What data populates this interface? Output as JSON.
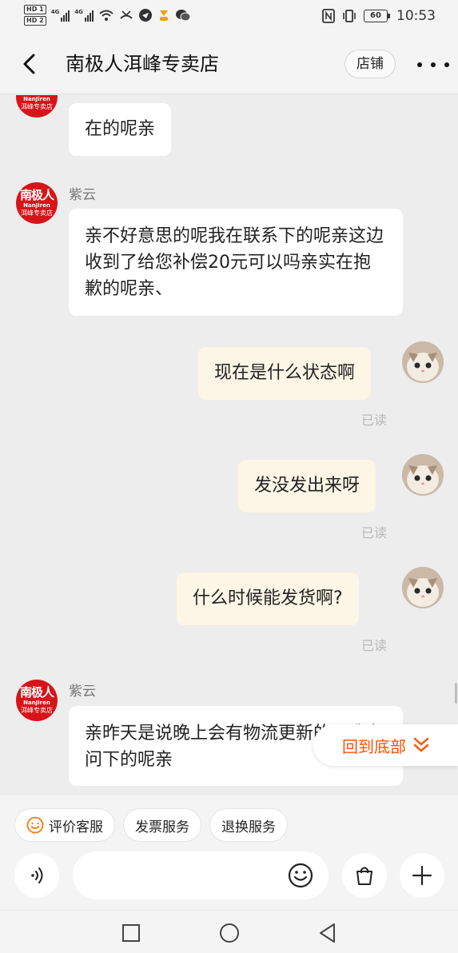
{
  "status_bar": {
    "sim1": "HD 1",
    "sim2": "HD 2",
    "net1": "4G",
    "net2": "4G",
    "battery": "60",
    "time": "10:53"
  },
  "header": {
    "title": "南极人洱峰专卖店",
    "shop_button": "店铺",
    "icons": {
      "back": "chevron-left-icon",
      "more": "more-dots-icon"
    }
  },
  "store_avatar": {
    "line1": "南极人",
    "line2": "NanJiren",
    "line3": "洱峰专卖店"
  },
  "messages": [
    {
      "side": "store",
      "text": "在的呢亲"
    },
    {
      "side": "store",
      "sender": "紫云",
      "text": "亲不好意思的呢我在联系下的呢亲这边收到了给您补偿20元可以吗亲实在抱歉的呢亲、"
    },
    {
      "side": "me",
      "text": "现在是什么状态啊",
      "status": "已读"
    },
    {
      "side": "me",
      "text": "发没发出来呀",
      "status": "已读"
    },
    {
      "side": "me",
      "text": "什么时候能发货啊?",
      "status": "已读"
    },
    {
      "side": "store",
      "sender": "紫云",
      "text": "亲昨天是说晚上会有物流更新的，我在问下的呢亲"
    }
  ],
  "jump_to_bottom": "回到底部",
  "quick_actions": [
    {
      "label": "评价客服",
      "icon": "smile-icon"
    },
    {
      "label": "发票服务"
    },
    {
      "label": "退换服务"
    }
  ],
  "input": {
    "placeholder": "",
    "icons": {
      "voice": "voice-icon",
      "emoji": "emoji-icon",
      "bag": "shopping-bag-icon",
      "plus": "plus-icon"
    }
  },
  "nav": {
    "icons": [
      "recents-square-icon",
      "home-circle-icon",
      "back-triangle-icon"
    ]
  },
  "colors": {
    "accent": "#ff5000",
    "store_red": "#d7141a",
    "my_bubble": "#fdf6e6"
  }
}
